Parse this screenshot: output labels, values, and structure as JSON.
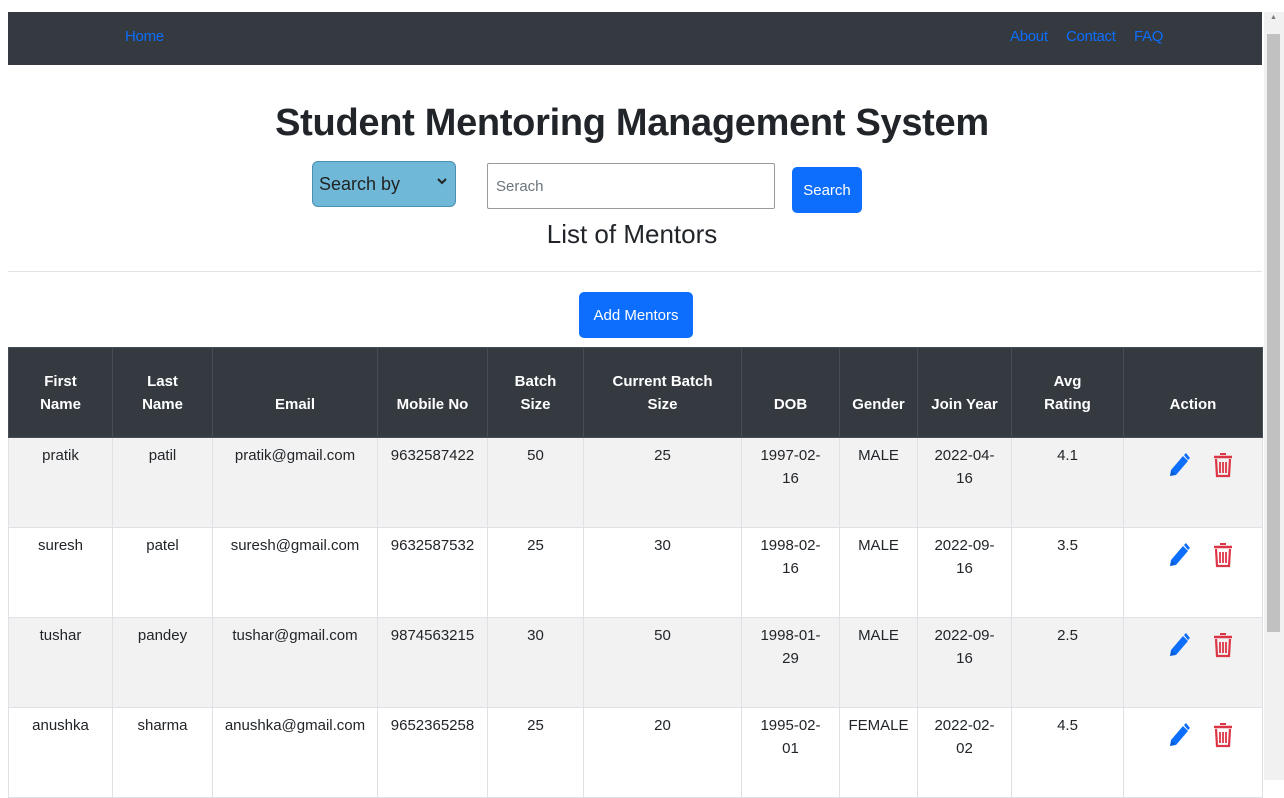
{
  "nav": {
    "home": "Home",
    "about": "About",
    "contact": "Contact",
    "faq": "FAQ"
  },
  "page_title": "Student Mentoring Management System",
  "search": {
    "select_label": "Search by",
    "placeholder": "Serach",
    "button": "Search"
  },
  "list_title": "List of Mentors",
  "add_button": "Add Mentors",
  "table": {
    "headers": {
      "first_name": [
        "First",
        "Name"
      ],
      "last_name": [
        "Last",
        "Name"
      ],
      "email": "Email",
      "mobile": "Mobile No",
      "batch_size": [
        "Batch",
        "Size"
      ],
      "current_batch_size": [
        "Current Batch",
        "Size"
      ],
      "dob": "DOB",
      "gender": "Gender",
      "join_year": "Join Year",
      "avg_rating": [
        "Avg",
        "Rating"
      ],
      "action": "Action"
    },
    "rows": [
      {
        "first_name": "pratik",
        "last_name": "patil",
        "email": "pratik@gmail.com",
        "mobile": "9632587422",
        "batch_size": "50",
        "current_batch_size": "25",
        "dob": [
          "1997-02-",
          "16"
        ],
        "gender": "MALE",
        "join_year": [
          "2022-04-",
          "16"
        ],
        "avg_rating": "4.1"
      },
      {
        "first_name": "suresh",
        "last_name": "patel",
        "email": "suresh@gmail.com",
        "mobile": "9632587532",
        "batch_size": "25",
        "current_batch_size": "30",
        "dob": [
          "1998-02-",
          "16"
        ],
        "gender": "MALE",
        "join_year": [
          "2022-09-",
          "16"
        ],
        "avg_rating": "3.5"
      },
      {
        "first_name": "tushar",
        "last_name": "pandey",
        "email": "tushar@gmail.com",
        "mobile": "9874563215",
        "batch_size": "30",
        "current_batch_size": "50",
        "dob": [
          "1998-01-",
          "29"
        ],
        "gender": "MALE",
        "join_year": [
          "2022-09-",
          "16"
        ],
        "avg_rating": "2.5"
      },
      {
        "first_name": "anushka",
        "last_name": "sharma",
        "email": "anushka@gmail.com",
        "mobile": "9652365258",
        "batch_size": "25",
        "current_batch_size": "20",
        "dob": [
          "1995-02-",
          "01"
        ],
        "gender": "FEMALE",
        "join_year": [
          "2022-02-",
          "02"
        ],
        "avg_rating": "4.5"
      }
    ]
  },
  "icons": {
    "edit": "pencil-icon",
    "delete": "trash-icon",
    "select_arrow": "chevron-down-icon"
  },
  "colors": {
    "navbar": "#343a40",
    "link": "#0d6efd",
    "primary_button": "#0d6efd",
    "select_bg": "#6fb8d8",
    "delete": "#dc3545",
    "row_striped": "#f2f2f2"
  }
}
